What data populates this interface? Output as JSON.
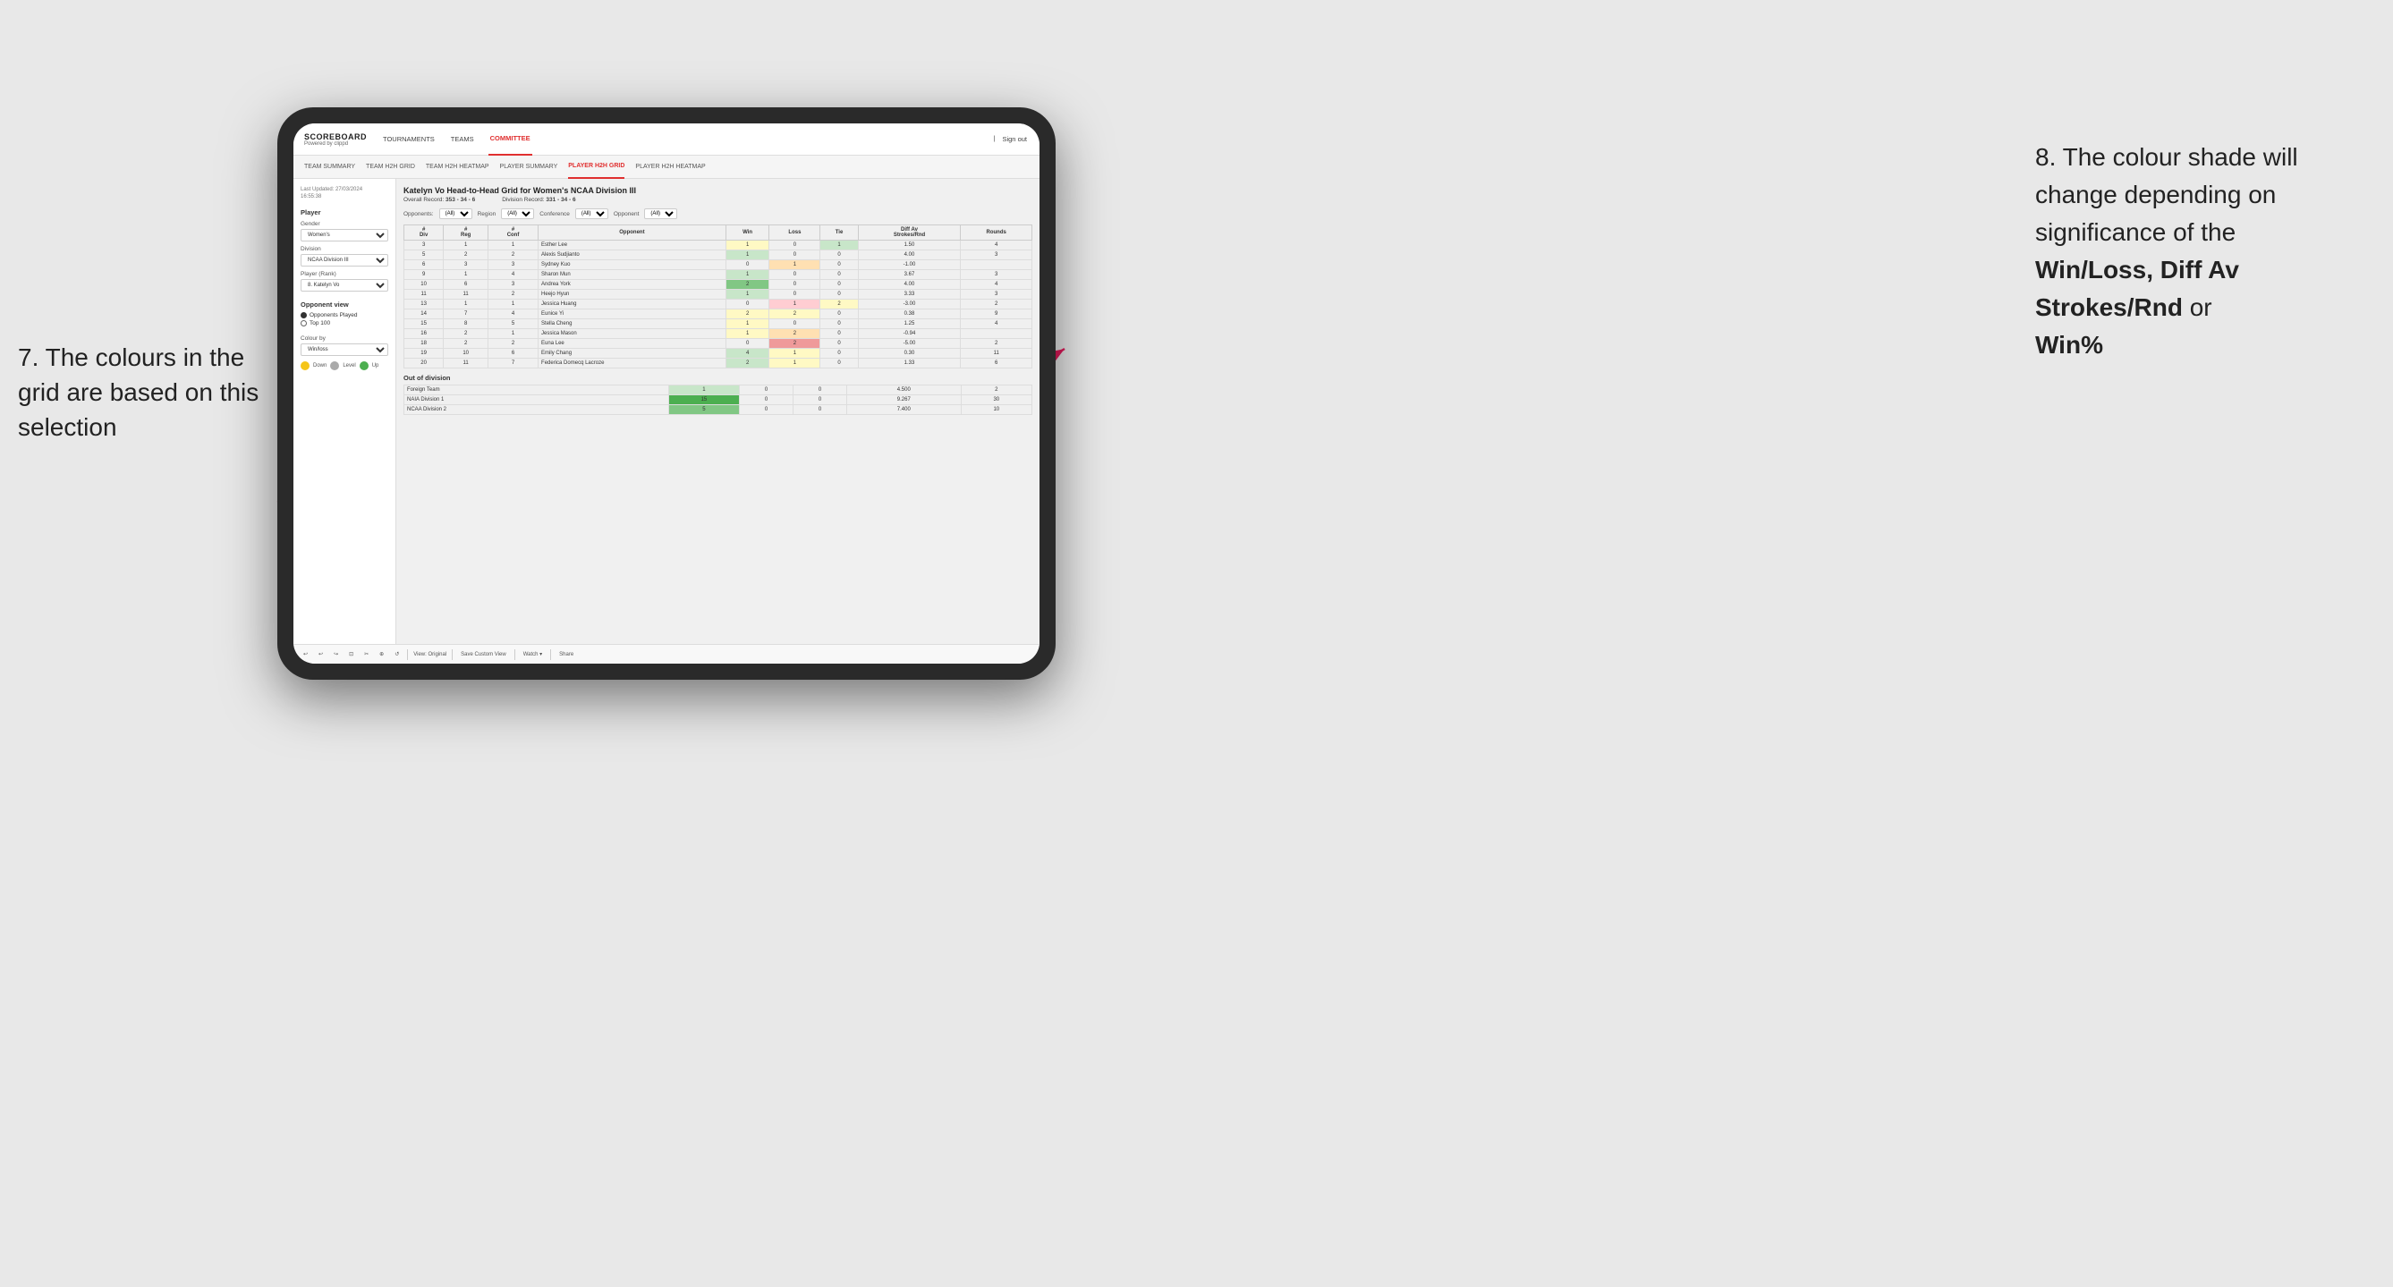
{
  "annotations": {
    "left_title": "7. The colours in the grid are based on this selection",
    "right_title": "8. The colour shade will change depending on significance of the",
    "right_bold1": "Win/Loss, Diff Av Strokes/Rnd",
    "right_bold2": "or",
    "right_bold3": "Win%"
  },
  "nav": {
    "logo": "SCOREBOARD",
    "logo_sub": "Powered by clippd",
    "items": [
      "TOURNAMENTS",
      "TEAMS",
      "COMMITTEE"
    ],
    "active": "COMMITTEE",
    "sign_in": "Sign out"
  },
  "sub_nav": {
    "items": [
      "TEAM SUMMARY",
      "TEAM H2H GRID",
      "TEAM H2H HEATMAP",
      "PLAYER SUMMARY",
      "PLAYER H2H GRID",
      "PLAYER H2H HEATMAP"
    ],
    "active": "PLAYER H2H GRID"
  },
  "sidebar": {
    "last_updated_label": "Last Updated: 27/03/2024",
    "last_updated_time": "16:55:38",
    "player_section": "Player",
    "gender_label": "Gender",
    "gender_value": "Women's",
    "division_label": "Division",
    "division_value": "NCAA Division III",
    "player_rank_label": "Player (Rank)",
    "player_rank_value": "8. Katelyn Vo",
    "opponent_view_label": "Opponent view",
    "radio_opponents": "Opponents Played",
    "radio_top100": "Top 100",
    "colour_by_label": "Colour by",
    "colour_by_value": "Win/loss",
    "legend": [
      {
        "color": "#f5c518",
        "label": "Down"
      },
      {
        "color": "#aaa",
        "label": "Level"
      },
      {
        "color": "#4caf50",
        "label": "Up"
      }
    ]
  },
  "grid": {
    "title": "Katelyn Vo Head-to-Head Grid for Women's NCAA Division III",
    "overall_record_label": "Overall Record:",
    "overall_record_value": "353 - 34 - 6",
    "division_record_label": "Division Record:",
    "division_record_value": "331 - 34 - 6",
    "filters": {
      "opponents_label": "Opponents:",
      "opponents_value": "(All)",
      "region_label": "Region",
      "region_value": "(All)",
      "conference_label": "Conference",
      "conference_value": "(All)",
      "opponent_label": "Opponent",
      "opponent_value": "(All)"
    },
    "columns": [
      "#\nDiv",
      "#\nReg",
      "#\nConf",
      "Opponent",
      "Win",
      "Loss",
      "Tie",
      "Diff Av\nStrokes/Rnd",
      "Rounds"
    ],
    "rows": [
      {
        "div": "3",
        "reg": "1",
        "conf": "1",
        "opponent": "Esther Lee",
        "win": 1,
        "loss": 0,
        "tie": 1,
        "diff": "1.50",
        "rounds": 4,
        "win_color": "yellow",
        "loss_color": "",
        "tie_color": "green_light"
      },
      {
        "div": "5",
        "reg": "2",
        "conf": "2",
        "opponent": "Alexis Sudjianto",
        "win": 1,
        "loss": 0,
        "tie": 0,
        "diff": "4.00",
        "rounds": 3,
        "win_color": "green_light",
        "loss_color": "",
        "tie_color": ""
      },
      {
        "div": "6",
        "reg": "3",
        "conf": "3",
        "opponent": "Sydney Kuo",
        "win": 0,
        "loss": 1,
        "tie": 0,
        "diff": "-1.00",
        "rounds": "",
        "win_color": "",
        "loss_color": "orange",
        "tie_color": ""
      },
      {
        "div": "9",
        "reg": "1",
        "conf": "4",
        "opponent": "Sharon Mun",
        "win": 1,
        "loss": 0,
        "tie": 0,
        "diff": "3.67",
        "rounds": 3,
        "win_color": "green_light",
        "loss_color": "",
        "tie_color": ""
      },
      {
        "div": "10",
        "reg": "6",
        "conf": "3",
        "opponent": "Andrea York",
        "win": 2,
        "loss": 0,
        "tie": 0,
        "diff": "4.00",
        "rounds": 4,
        "win_color": "green_med",
        "loss_color": "",
        "tie_color": ""
      },
      {
        "div": "11",
        "reg": "11",
        "conf": "2",
        "opponent": "Heejo Hyun",
        "win": 1,
        "loss": 0,
        "tie": 0,
        "diff": "3.33",
        "rounds": 3,
        "win_color": "green_light",
        "loss_color": "",
        "tie_color": ""
      },
      {
        "div": "13",
        "reg": "1",
        "conf": "1",
        "opponent": "Jessica Huang",
        "win": 0,
        "loss": 1,
        "tie": 2,
        "diff": "-3.00",
        "rounds": 2,
        "win_color": "",
        "loss_color": "red_light",
        "tie_color": "yellow"
      },
      {
        "div": "14",
        "reg": "7",
        "conf": "4",
        "opponent": "Eunice Yi",
        "win": 2,
        "loss": 2,
        "tie": 0,
        "diff": "0.38",
        "rounds": 9,
        "win_color": "yellow",
        "loss_color": "yellow",
        "tie_color": ""
      },
      {
        "div": "15",
        "reg": "8",
        "conf": "5",
        "opponent": "Stella Cheng",
        "win": 1,
        "loss": 0,
        "tie": 0,
        "diff": "1.25",
        "rounds": 4,
        "win_color": "yellow",
        "loss_color": "",
        "tie_color": ""
      },
      {
        "div": "16",
        "reg": "2",
        "conf": "1",
        "opponent": "Jessica Mason",
        "win": 1,
        "loss": 2,
        "tie": 0,
        "diff": "-0.94",
        "rounds": "",
        "win_color": "yellow",
        "loss_color": "orange",
        "tie_color": ""
      },
      {
        "div": "18",
        "reg": "2",
        "conf": "2",
        "opponent": "Euna Lee",
        "win": 0,
        "loss": 2,
        "tie": 0,
        "diff": "-5.00",
        "rounds": 2,
        "win_color": "",
        "loss_color": "red",
        "tie_color": ""
      },
      {
        "div": "19",
        "reg": "10",
        "conf": "6",
        "opponent": "Emily Chang",
        "win": 4,
        "loss": 1,
        "tie": 0,
        "diff": "0.30",
        "rounds": 11,
        "win_color": "green_light",
        "loss_color": "yellow",
        "tie_color": ""
      },
      {
        "div": "20",
        "reg": "11",
        "conf": "7",
        "opponent": "Federica Domecq Lacroze",
        "win": 2,
        "loss": 1,
        "tie": 0,
        "diff": "1.33",
        "rounds": 6,
        "win_color": "green_light",
        "loss_color": "yellow",
        "tie_color": ""
      }
    ],
    "out_of_division": {
      "title": "Out of division",
      "rows": [
        {
          "opponent": "Foreign Team",
          "win": 1,
          "loss": 0,
          "tie": 0,
          "diff": "4.500",
          "rounds": 2,
          "win_color": "green_light"
        },
        {
          "opponent": "NAIA Division 1",
          "win": 15,
          "loss": 0,
          "tie": 0,
          "diff": "9.267",
          "rounds": 30,
          "win_color": "green_dark"
        },
        {
          "opponent": "NCAA Division 2",
          "win": 5,
          "loss": 0,
          "tie": 0,
          "diff": "7.400",
          "rounds": 10,
          "win_color": "green_med"
        }
      ]
    }
  },
  "toolbar": {
    "buttons": [
      "↩",
      "↩",
      "↪",
      "⊡",
      "✂",
      "⊕",
      "↺"
    ],
    "view_original": "View: Original",
    "save_custom": "Save Custom View",
    "watch": "Watch ▾",
    "share": "Share"
  }
}
